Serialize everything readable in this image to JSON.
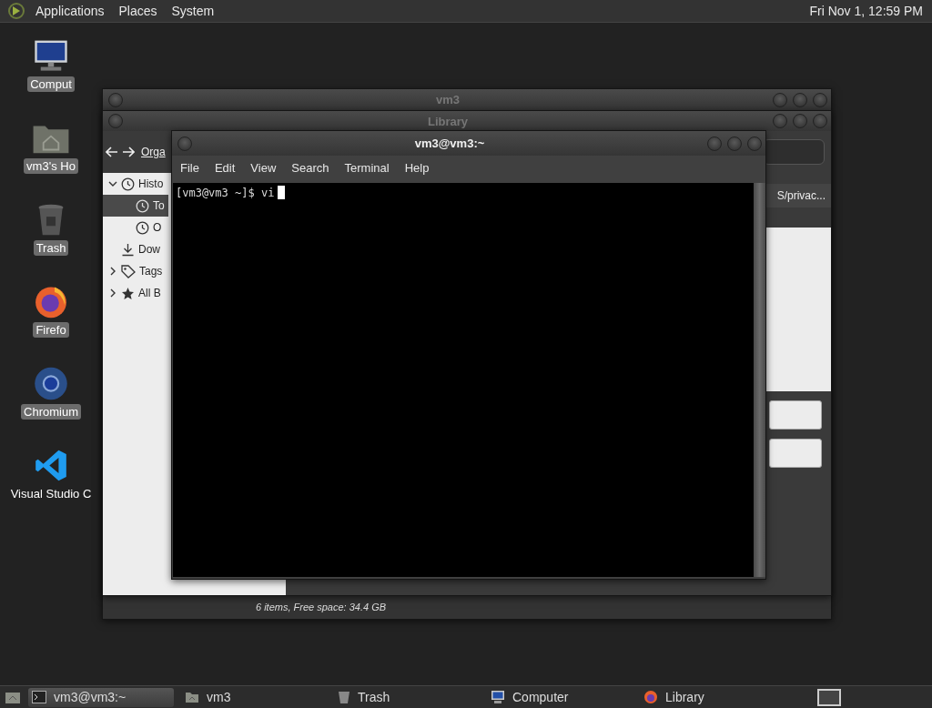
{
  "top_panel": {
    "menus": [
      "Applications",
      "Places",
      "System"
    ],
    "clock": "Fri Nov 1, 12:59 PM"
  },
  "desktop_icons": [
    {
      "kind": "computer",
      "label": "Comput"
    },
    {
      "kind": "home",
      "label": "vm3's Ho"
    },
    {
      "kind": "trash",
      "label": "Trash"
    },
    {
      "kind": "firefox",
      "label": "Firefo"
    },
    {
      "kind": "chromium",
      "label": "Chromium"
    },
    {
      "kind": "vscode",
      "label": "Visual Studio C"
    }
  ],
  "file_manager": {
    "title": "vm3",
    "status": "6 items, Free space: 34.4 GB"
  },
  "library": {
    "title": "Library",
    "toolbar": "Orga",
    "column_header": "S/privac...",
    "tree": [
      {
        "kind": "clock",
        "label": "Histo",
        "expanded": true,
        "selected": false,
        "children": [
          {
            "kind": "clock",
            "label": "To",
            "selected": true
          },
          {
            "kind": "clock",
            "label": "O",
            "selected": false
          }
        ]
      },
      {
        "kind": "download",
        "label": "Dow",
        "selected": false
      },
      {
        "kind": "tag",
        "label": "Tags",
        "expanded": false,
        "selected": false
      },
      {
        "kind": "star",
        "label": "All B",
        "expanded": false,
        "selected": false
      }
    ]
  },
  "terminal": {
    "title": "vm3@vm3:~",
    "menus": [
      "File",
      "Edit",
      "View",
      "Search",
      "Terminal",
      "Help"
    ],
    "lines": [
      "[vm3@vm3 ~]$ vi"
    ]
  },
  "taskbar": {
    "tasks": [
      {
        "kind": "terminal",
        "label": "vm3@vm3:~",
        "selected": true
      },
      {
        "kind": "home",
        "label": "vm3",
        "selected": false
      },
      {
        "kind": "trash",
        "label": "Trash",
        "selected": false
      },
      {
        "kind": "computer",
        "label": "Computer",
        "selected": false
      },
      {
        "kind": "firefox",
        "label": "Library",
        "selected": false
      }
    ]
  }
}
